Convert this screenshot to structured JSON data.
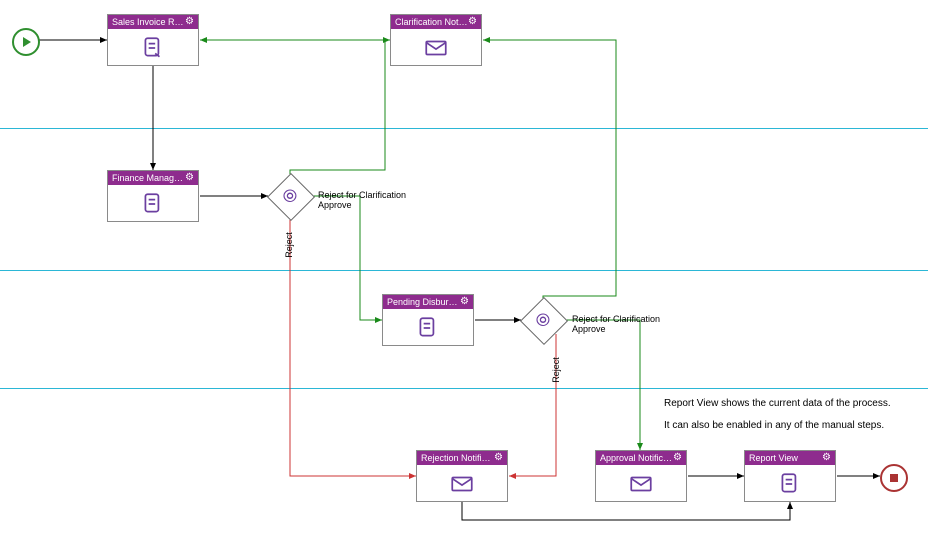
{
  "diagram": {
    "type": "bpmn-workflow",
    "lanes": 4,
    "nodes": {
      "start": {
        "kind": "start-event"
      },
      "n1": {
        "title": "Sales Invoice Request",
        "icon": "form"
      },
      "n2": {
        "title": "Clarification Notifi...",
        "icon": "mail"
      },
      "n3": {
        "title": "Finance Manager Appr...",
        "icon": "form"
      },
      "gw1": {
        "kind": "gateway"
      },
      "n4": {
        "title": "Pending Disbursement",
        "icon": "form"
      },
      "gw2": {
        "kind": "gateway"
      },
      "n5": {
        "title": "Rejection Notificati...",
        "icon": "mail"
      },
      "n6": {
        "title": "Approval Notification",
        "icon": "mail"
      },
      "n7": {
        "title": "Report View",
        "icon": "form"
      },
      "end": {
        "kind": "end-event"
      }
    },
    "edge_labels": {
      "gw1_clar": "Reject for Clarification",
      "gw1_appr": "Approve",
      "gw1_rej": "Reject",
      "gw2_clar": "Reject for Clarification",
      "gw2_appr": "Approve",
      "gw2_rej": "Reject"
    },
    "edges": [
      {
        "from": "start",
        "to": "n1",
        "style": "black"
      },
      {
        "from": "n1",
        "to": "n3",
        "style": "black"
      },
      {
        "from": "n3",
        "to": "gw1",
        "style": "black"
      },
      {
        "from": "gw1",
        "to": "n2",
        "label": "gw1_clar",
        "style": "green"
      },
      {
        "from": "gw1",
        "to": "n4",
        "label": "gw1_appr",
        "style": "green"
      },
      {
        "from": "gw1",
        "to": "n5",
        "label": "gw1_rej",
        "style": "red"
      },
      {
        "from": "n2",
        "to": "n1",
        "style": "green"
      },
      {
        "from": "n4",
        "to": "gw2",
        "style": "black"
      },
      {
        "from": "gw2",
        "to": "n2",
        "label": "gw2_clar",
        "style": "green"
      },
      {
        "from": "gw2",
        "to": "n6",
        "label": "gw2_appr",
        "style": "green"
      },
      {
        "from": "gw2",
        "to": "n5",
        "label": "gw2_rej",
        "style": "red"
      },
      {
        "from": "n5",
        "to": "n7",
        "style": "black"
      },
      {
        "from": "n6",
        "to": "n7",
        "style": "black"
      },
      {
        "from": "n7",
        "to": "end",
        "style": "black"
      }
    ],
    "annotations": {
      "a1": "Report View shows the current data of the process.",
      "a2": "It can also be enabled in any of the manual steps."
    }
  }
}
